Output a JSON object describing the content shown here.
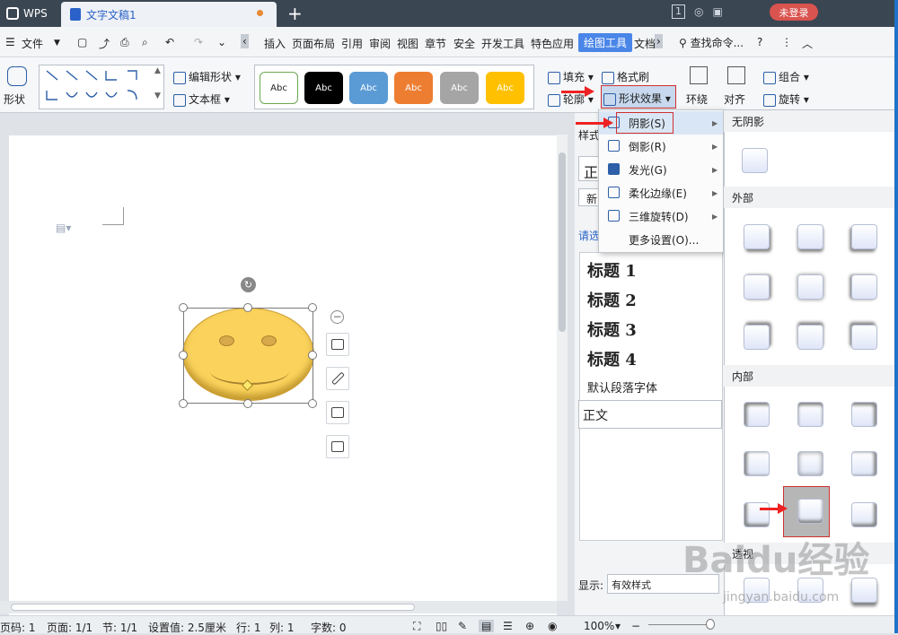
{
  "titlebar": {
    "app": "WPS",
    "doc_tab": "文字文稿1",
    "new_tab": "+",
    "page_num": "1",
    "login": "未登录"
  },
  "menubar": {
    "file": "文件",
    "items": [
      "插入",
      "页面布局",
      "引用",
      "审阅",
      "视图",
      "章节",
      "安全",
      "开发工具",
      "特色应用",
      "绘图工具",
      "文档"
    ],
    "active": "绘图工具",
    "search": "查找命令...",
    "help": "?"
  },
  "ribbon": {
    "shape": "形状",
    "edit_shape": "编辑形状",
    "textbox": "文本框",
    "styles": [
      "Abc",
      "Abc",
      "Abc",
      "Abc",
      "Abc",
      "Abc"
    ],
    "style_colors": [
      "#ffffff",
      "#000000",
      "#5b9bd5",
      "#ed7d31",
      "#a5a5a5",
      "#ffc000"
    ],
    "fill": "填充",
    "outline": "轮廓",
    "format_painter": "格式刷",
    "shape_effect": "形状效果",
    "wrap": "环绕",
    "align": "对齐",
    "group": "组合",
    "rotate": "旋转"
  },
  "pane": {
    "style_label": "样式",
    "zheng": "正",
    "new": "新",
    "choose": "请选",
    "headings": [
      "标题 1",
      "标题 2",
      "标题 3",
      "标题 4"
    ],
    "default_font": "默认段落字体",
    "body": "正文",
    "show_label": "显示:",
    "show_value": "有效样式"
  },
  "effect_menu": {
    "items": [
      "阴影(S)",
      "倒影(R)",
      "发光(G)",
      "柔化边缘(E)",
      "三维旋转(D)",
      "更多设置(O)..."
    ]
  },
  "shadow_panel": {
    "no_shadow": "无阴影",
    "outer": "外部",
    "inner": "内部",
    "perspective": "透视"
  },
  "status": {
    "page_num": "页码: 1",
    "pages": "页面: 1/1",
    "section": "节: 1/1",
    "setting": "设置值: 2.5厘米",
    "row": "行: 1",
    "col": "列: 1",
    "words": "字数: 0",
    "zoom": "100%"
  },
  "watermark": {
    "brand": "Baidu经验",
    "url": "jingyan.baidu.com"
  }
}
